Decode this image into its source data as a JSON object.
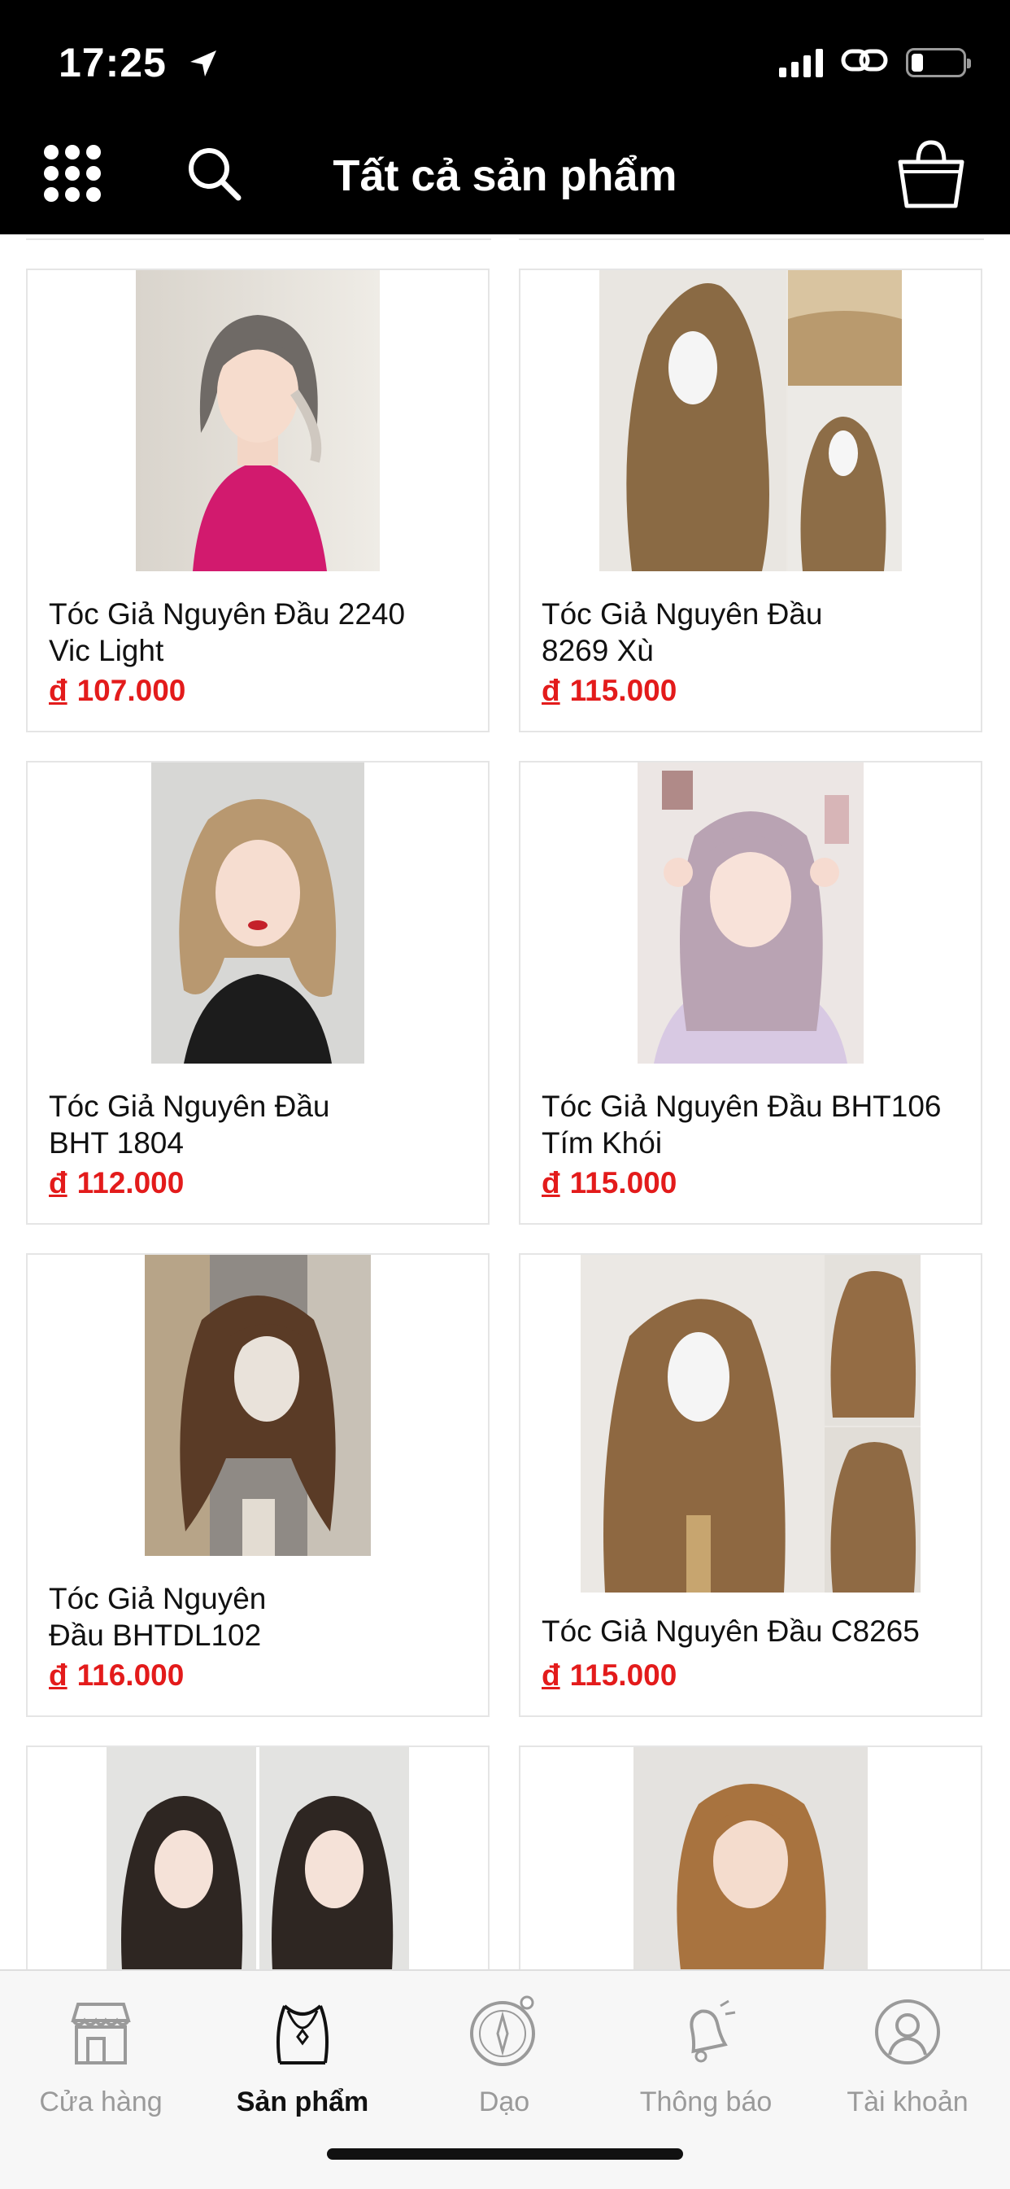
{
  "status_bar": {
    "time": "17:25",
    "battery_level": 0.22
  },
  "header": {
    "title": "Tất cả sản phẩm",
    "menu_icon": "grid-menu-icon",
    "search_icon": "search-icon",
    "cart_icon": "shopping-bag-icon"
  },
  "products": [
    {
      "name": "Tóc Giả Nguyên Đầu 2240\nVic Light",
      "currency": "đ",
      "price": "107.000",
      "image": "wig-photo-short-bob"
    },
    {
      "name": "Tóc Giả Nguyên Đầu\n8269 Xù",
      "currency": "đ",
      "price": "115.000",
      "image": "wig-photo-long-wavy-mannequin"
    },
    {
      "name": "Tóc Giả Nguyên Đầu\nBHT 1804",
      "currency": "đ",
      "price": "112.000",
      "image": "wig-photo-medium-blonde"
    },
    {
      "name": "Tóc Giả Nguyên Đầu BHT106\nTím Khói",
      "currency": "đ",
      "price": "115.000",
      "image": "wig-photo-lilac-long"
    },
    {
      "name": "Tóc Giả Nguyên\nĐầu BHTDL102",
      "currency": "đ",
      "price": "116.000",
      "image": "wig-photo-brown-curly"
    },
    {
      "name": "Tóc Giả Nguyên Đầu C8265",
      "currency": "đ",
      "price": "115.000",
      "image": "wig-photo-caramel-wavy"
    },
    {
      "name": "",
      "currency": "",
      "price": "",
      "image": "wig-photo-dark-wavy-pair"
    },
    {
      "name": "",
      "currency": "",
      "price": "",
      "image": "wig-photo-copper-long"
    }
  ],
  "tabs": [
    {
      "label": "Cửa hàng",
      "icon": "storefront-icon",
      "active": false
    },
    {
      "label": "Sản phẩm",
      "icon": "necklace-icon",
      "active": true
    },
    {
      "label": "Dạo",
      "icon": "compass-icon",
      "active": false
    },
    {
      "label": "Thông báo",
      "icon": "bell-icon",
      "active": false
    },
    {
      "label": "Tài khoản",
      "icon": "user-icon",
      "active": false
    }
  ],
  "colors": {
    "price": "#e31b1b",
    "header_bg": "#000000",
    "tabbar_bg": "#f7f7f7"
  }
}
